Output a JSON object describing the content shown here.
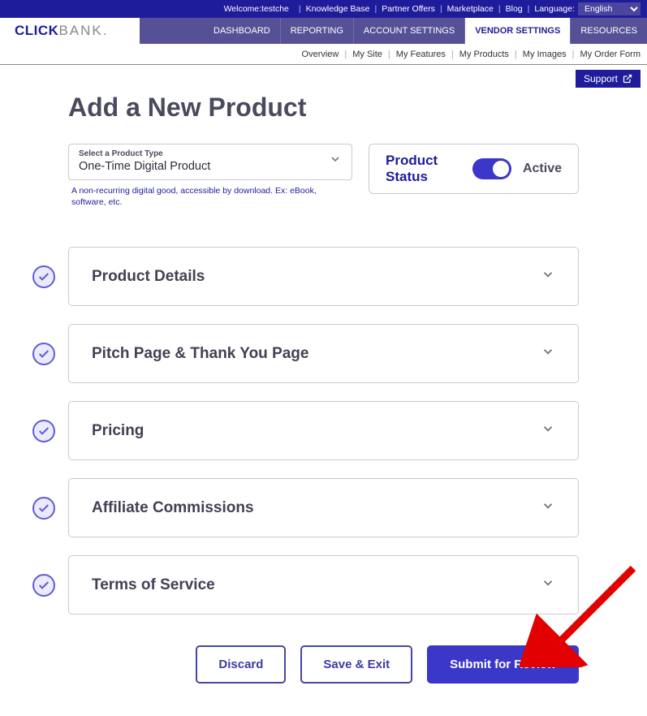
{
  "topbar": {
    "welcome": "Welcome:testche",
    "links": [
      "Knowledge Base",
      "Partner Offers",
      "Marketplace",
      "Blog"
    ],
    "language_label": "Language:",
    "language_value": "English"
  },
  "logo": {
    "part1": "CLICK",
    "part2": "BANK",
    "dot": "."
  },
  "nav": {
    "items": [
      "DASHBOARD",
      "REPORTING",
      "ACCOUNT SETTINGS",
      "VENDOR SETTINGS",
      "RESOURCES"
    ],
    "active_index": 3
  },
  "subnav": {
    "items": [
      "Overview",
      "My Site",
      "My Features",
      "My Products",
      "My Images",
      "My Order Form"
    ]
  },
  "support_label": "Support",
  "page_title": "Add a New Product",
  "product_type": {
    "label": "Select a Product Type",
    "value": "One-Time Digital Product",
    "help": "A non-recurring digital good, accessible by download. Ex: eBook, software, etc."
  },
  "status": {
    "label": "Product Status",
    "state_label": "Active"
  },
  "sections": [
    {
      "title": "Product Details"
    },
    {
      "title": "Pitch Page & Thank You Page"
    },
    {
      "title": "Pricing"
    },
    {
      "title": "Affiliate Commissions"
    },
    {
      "title": "Terms of Service"
    }
  ],
  "buttons": {
    "discard": "Discard",
    "save_exit": "Save & Exit",
    "submit": "Submit for Review"
  }
}
